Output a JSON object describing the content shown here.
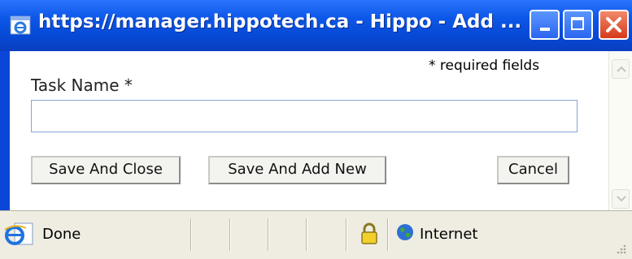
{
  "window": {
    "title": "https://manager.hippotech.ca - Hippo - Add ..."
  },
  "form": {
    "required_note": "* required fields",
    "task_label": "Task Name *",
    "task_value": ""
  },
  "buttons": {
    "save_close": "Save And Close",
    "save_new": "Save And Add New",
    "cancel": "Cancel"
  },
  "statusbar": {
    "status": "Done",
    "zone": "Internet"
  },
  "icons": {
    "title": "ie-page-icon",
    "minimize": "minimize-icon",
    "maximize": "maximize-icon",
    "close": "close-icon",
    "status": "ie-page-icon",
    "security": "padlock-icon",
    "zone": "globe-icon"
  },
  "colors": {
    "titlebar": "#0d57e8",
    "close_button": "#d6391a",
    "statusbar": "#efede2"
  }
}
